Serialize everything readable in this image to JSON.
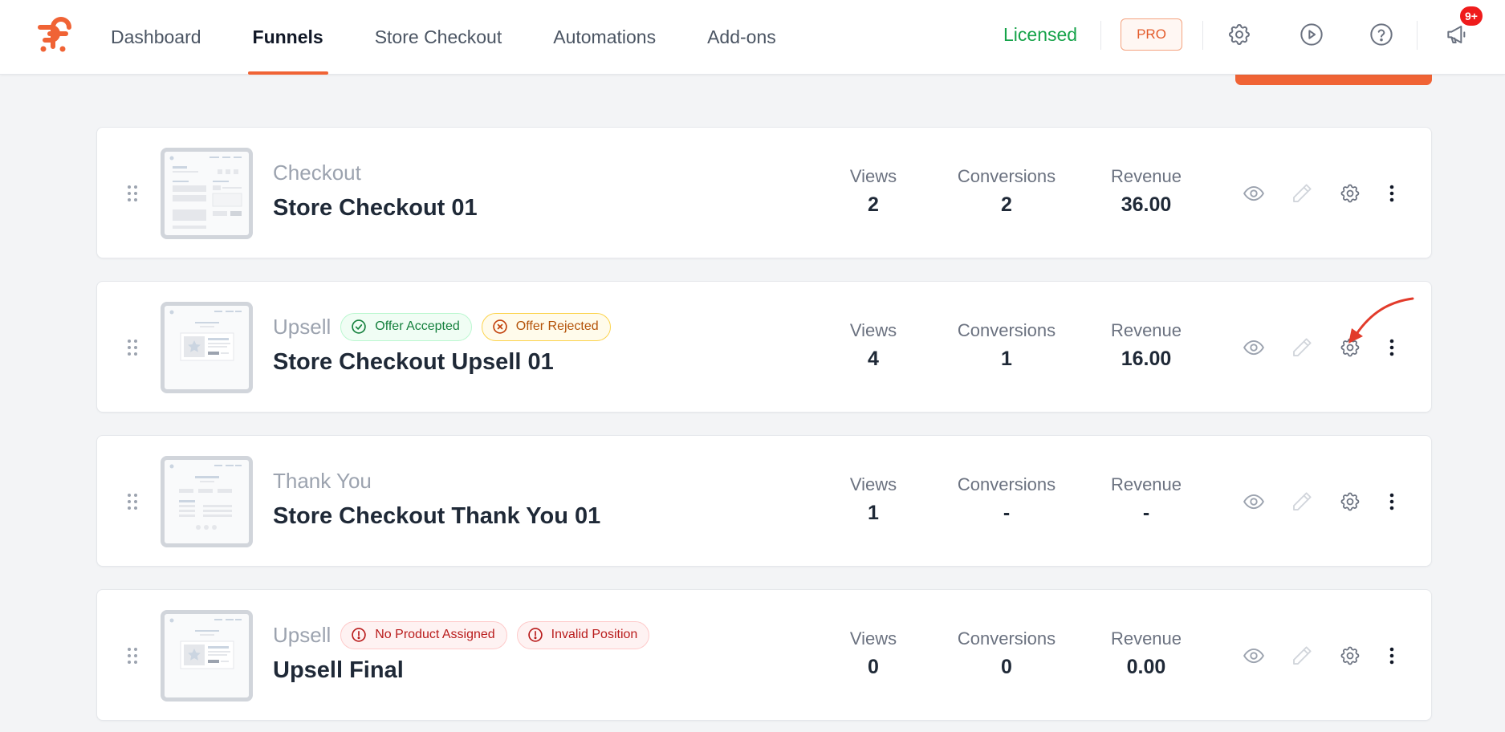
{
  "nav": {
    "items": [
      {
        "label": "Dashboard",
        "active": false
      },
      {
        "label": "Funnels",
        "active": true
      },
      {
        "label": "Store Checkout",
        "active": false
      },
      {
        "label": "Automations",
        "active": false
      },
      {
        "label": "Add-ons",
        "active": false
      }
    ]
  },
  "header": {
    "license_status": "Licensed",
    "pro_label": "PRO",
    "notification_count": "9+",
    "icons": [
      "gear-icon",
      "play-icon",
      "help-icon",
      "megaphone-icon"
    ]
  },
  "colors": {
    "brand": "#f06335",
    "licensed": "#16a34a",
    "badge_success": "#15803d",
    "badge_warning": "#b45309",
    "badge_error": "#b91c1c",
    "notification": "#ef1c1c"
  },
  "stat_labels": {
    "views": "Views",
    "conversions": "Conversions",
    "revenue": "Revenue"
  },
  "steps": [
    {
      "type": "Checkout",
      "title": "Store Checkout 01",
      "views": "2",
      "conversions": "2",
      "revenue": "36.00",
      "badges": []
    },
    {
      "type": "Upsell",
      "title": "Store Checkout Upsell 01",
      "views": "4",
      "conversions": "1",
      "revenue": "16.00",
      "badges": [
        {
          "label": "Offer Accepted",
          "icon": "check-circle-icon"
        },
        {
          "label": "Offer Rejected",
          "icon": "x-circle-icon"
        }
      ]
    },
    {
      "type": "Thank You",
      "title": "Store Checkout Thank You 01",
      "views": "1",
      "conversions": "-",
      "revenue": "-",
      "badges": []
    },
    {
      "type": "Upsell",
      "title": "Upsell Final",
      "views": "0",
      "conversions": "0",
      "revenue": "0.00",
      "badges": [
        {
          "label": "No Product Assigned",
          "icon": "alert-circle-icon"
        },
        {
          "label": "Invalid Position",
          "icon": "alert-circle-icon"
        }
      ]
    }
  ]
}
